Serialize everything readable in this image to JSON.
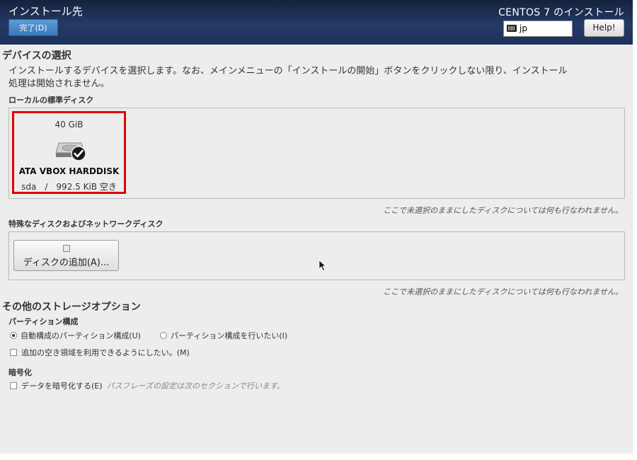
{
  "header": {
    "title": "インストール先",
    "done_label": "完了(D)",
    "product": "CENTOS 7 のインストール",
    "keyboard": "jp",
    "help_label": "Help!"
  },
  "device_selection": {
    "heading": "デバイスの選択",
    "description_line1": "インストールするデバイスを選択します。なお、メインメニューの「インストールの開始」ボタンをクリックしない限り、インストール",
    "description_line2": "処理は開始されません。",
    "local_heading": "ローカルの標準ディスク",
    "disk": {
      "size": "40 GiB",
      "name": "ATA VBOX HARDDISK",
      "detail": "sda　/　992.5 KiB 空き"
    },
    "local_note": "ここで未選択のままにしたディスクについては何も行なわれません。",
    "special_heading": "特殊なディスクおよびネットワークディスク",
    "add_disk_label": "ディスクの追加(A)...",
    "special_note": "ここで未選択のままにしたディスクについては何も行なわれません。"
  },
  "other_options": {
    "heading": "その他のストレージオプション",
    "partition_heading": "パーティション構成",
    "auto_partition": "自動構成のパーティション構成(U)",
    "manual_partition": "パーティション構成を行いたい(I)",
    "extra_space": "追加の空き領域を利用できるようにしたい。(M)",
    "encryption_heading": "暗号化",
    "encrypt_label": "データを暗号化する(E)",
    "encrypt_hint": "パスフレーズの設定は次のセクションで行います。"
  },
  "colors": {
    "header_bg": "#1d3159",
    "done_button": "#3a78bd",
    "selection_highlight": "#e00000"
  }
}
